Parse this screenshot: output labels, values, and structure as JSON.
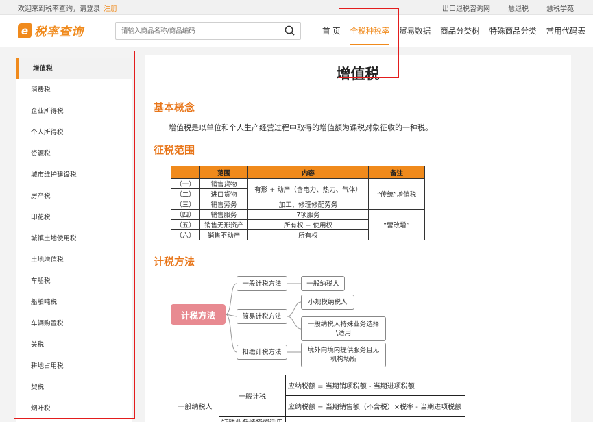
{
  "topbar": {
    "welcome": "欢迎来到税率查询，请登录",
    "register": "注册",
    "links": [
      "出口退税咨询网",
      "慧退税",
      "慧税学苑"
    ]
  },
  "header": {
    "logo_mark": "e",
    "logo_text": "税率查询",
    "search_placeholder": "请输入商品名称/商品编码",
    "nav": [
      "首 页",
      "全税种税率",
      "贸易数据",
      "商品分类树",
      "特殊商品分类",
      "常用代码表"
    ],
    "active_nav": 1
  },
  "sidebar": {
    "items": [
      "增值税",
      "消费税",
      "企业所得税",
      "个人所得税",
      "资源税",
      "城市维护建设税",
      "房产税",
      "印花税",
      "城镇土地使用税",
      "土地增值税",
      "车船税",
      "船舶吨税",
      "车辆购置税",
      "关税",
      "耕地占用税",
      "契税",
      "烟叶税"
    ],
    "active": 0
  },
  "main": {
    "title": "增值税",
    "sections": {
      "concept": "基本概念",
      "scope": "征税范围",
      "method": "计税方法"
    },
    "concept_text": "增值税是以单位和个人生产经营过程中取得的增值额为课税对象征收的一种税。",
    "scope_table": {
      "headers": [
        "",
        "范围",
        "内容",
        "备注"
      ],
      "rows": [
        [
          "（一）",
          "销售货物"
        ],
        [
          "（二）",
          "进口货物"
        ],
        [
          "（三）",
          "销售劳务"
        ],
        [
          "（四）",
          "销售服务"
        ],
        [
          "（五）",
          "销售无形资产"
        ],
        [
          "（六）",
          "销售不动产"
        ]
      ],
      "content": {
        "goods": "有形 + 动产（含电力、热力、气体）",
        "labor": "加工、修理修配劳务",
        "service": "7项服务",
        "intangible": "所有权 + 使用权",
        "realestate": "所有权"
      },
      "notes": {
        "traditional": "“传统”增值税",
        "reform": "“营改增”"
      }
    },
    "mindmap": {
      "root": "计税方法",
      "branches": [
        "一般计税方法",
        "简易计税方法",
        "扣缴计税方法"
      ],
      "leaves": [
        "一般纳税人",
        "小规模纳税人",
        "一般纳税人特殊业务选择\\适用",
        "境外向境内提供服务且无机构场所"
      ]
    },
    "formula_table": {
      "taxpayer": "一般纳税人",
      "method": "一般计税",
      "formula1": "应纳税额 = 当期销项税额 - 当期进项税额",
      "formula2": "应纳税额 = 当期销售额（不含税）×税率 - 当期进项税额",
      "partial": "特殊业务选择或适用"
    }
  }
}
